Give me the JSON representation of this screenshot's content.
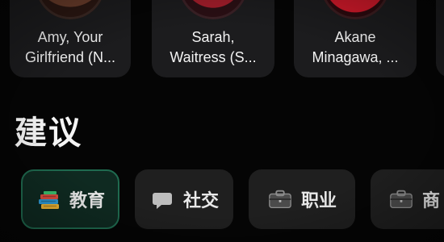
{
  "characters": [
    {
      "name": "Amy, Your\nGirlfriend (N..."
    },
    {
      "name": "Sarah,\nWaitress (S..."
    },
    {
      "name": "Akane\nMinagawa, ..."
    }
  ],
  "suggestions": {
    "title": "建议",
    "chips": [
      {
        "label": "教育",
        "icon": "books-icon",
        "active": true
      },
      {
        "label": "社交",
        "icon": "speech-bubble-icon",
        "active": false
      },
      {
        "label": "职业",
        "icon": "briefcase-icon",
        "active": false
      },
      {
        "label": "商",
        "icon": "briefcase-icon",
        "active": false
      }
    ]
  },
  "colors": {
    "background": "#050505",
    "card": "#1c1c1e",
    "chip": "#1f1f1f",
    "chip_active_bg": "#0f2a21",
    "chip_active_border": "#1f6a4f"
  }
}
